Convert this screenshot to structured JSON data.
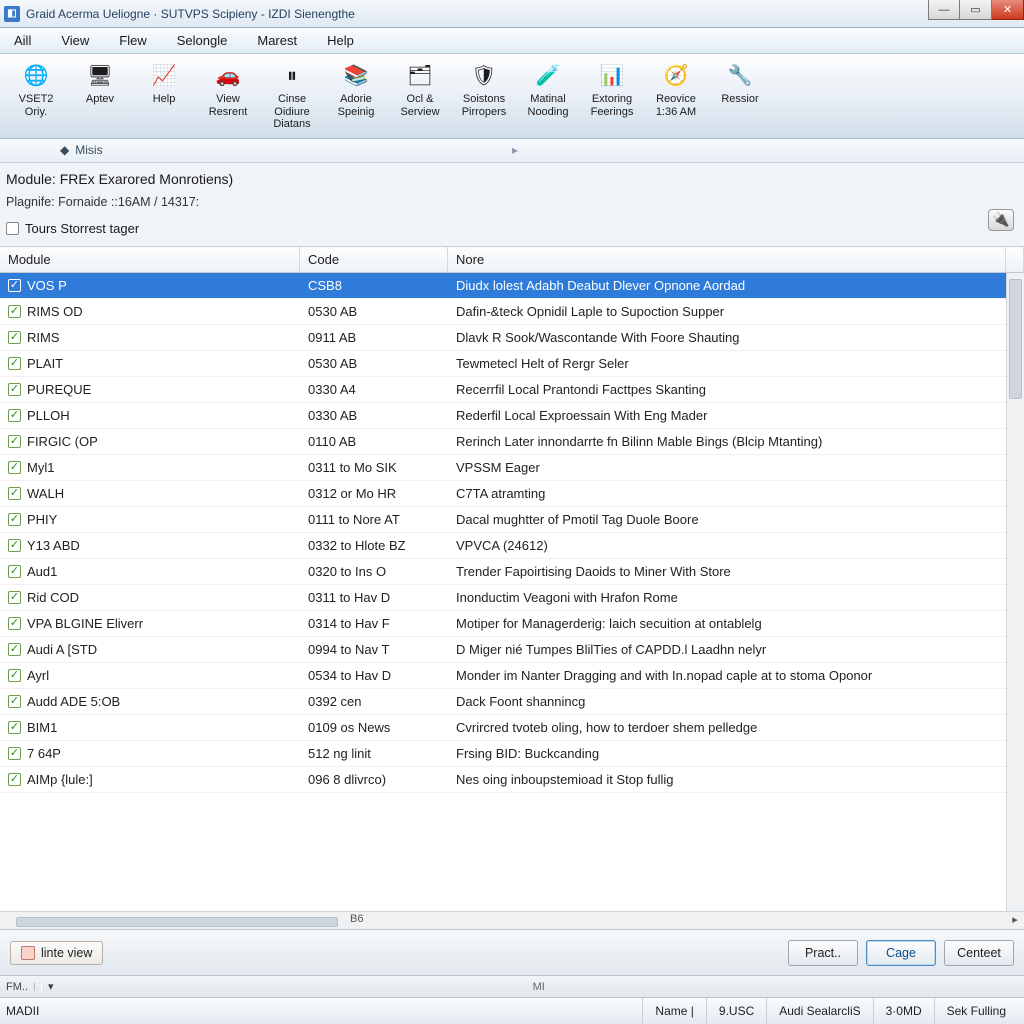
{
  "window": {
    "title": "Graid Acerma Ueliogne · SUTVPS Scipieny - IZDI Sienengthe"
  },
  "menu": {
    "items": [
      "Aill",
      "View",
      "Flew",
      "Selongle",
      "Marest",
      "Help"
    ]
  },
  "ribbon": {
    "buttons": [
      {
        "id": "vset2",
        "line1": "VSET2",
        "line2": "Oriy.",
        "icon": "🌐"
      },
      {
        "id": "aptev",
        "line1": "Aptev",
        "line2": "",
        "icon": "🖥"
      },
      {
        "id": "help",
        "line1": "Help",
        "line2": "",
        "icon": "📈"
      },
      {
        "id": "view-resent",
        "line1": "View",
        "line2": "Resrent",
        "icon": "🚗"
      },
      {
        "id": "cinse",
        "line1": "Cinse",
        "line2": "Oidiure Diatans",
        "icon": "⏸"
      },
      {
        "id": "adobe",
        "line1": "Adorie",
        "line2": "Speinig",
        "icon": "📚"
      },
      {
        "id": "ocl",
        "line1": "Ocl &",
        "line2": "Serview",
        "icon": "🗂"
      },
      {
        "id": "soistons",
        "line1": "Soistons",
        "line2": "Pirropers",
        "icon": "🛡"
      },
      {
        "id": "matinal",
        "line1": "Matinal",
        "line2": "Nooding",
        "icon": "🧪"
      },
      {
        "id": "extoring",
        "line1": "Extoring",
        "line2": "Feerings",
        "icon": "📊"
      },
      {
        "id": "reovice",
        "line1": "Reovice",
        "line2": "1:36 AM",
        "icon": "🧭"
      },
      {
        "id": "ressior",
        "line1": "Ressior",
        "line2": "",
        "icon": "🔧"
      }
    ]
  },
  "breadcrumb": {
    "label": "Misis"
  },
  "context": {
    "module_label": "Module: FREx Exarored Monrotiens)",
    "plagnife": "Plagnife: Fornaide ::16AM / 14317:",
    "toggle_label": "Tours Storrest tager"
  },
  "table": {
    "columns": {
      "module": "Module",
      "code": "Code",
      "note": "Nore"
    },
    "hscroll_label": "B6",
    "rows": [
      {
        "checked": true,
        "module": "VOS P",
        "code": "CSB8",
        "note": "Diudx lolest Adabh Deabut Dlever Opnone Aordad",
        "selected": true
      },
      {
        "checked": true,
        "module": "RIMS OD",
        "code": "0530 AB",
        "note": "Dafin-&teck Opnidil Laple to Supoction Supper"
      },
      {
        "checked": true,
        "module": "RIMS",
        "code": "0911 AB",
        "note": "Dlavk R Sook/Wascontande With Foore Shauting"
      },
      {
        "checked": true,
        "module": "PLAIT",
        "code": "0530 AB",
        "note": "Tewmetecl Helt of Rergr Seler"
      },
      {
        "checked": true,
        "module": "PUREQUE",
        "code": "0330 A4",
        "note": "Recerrfil Local Prantondi Facttpes Skanting"
      },
      {
        "checked": true,
        "module": "PLLOH",
        "code": "0330 AB",
        "note": "Rederfil Local Exproessain With Eng Mader"
      },
      {
        "checked": true,
        "module": "FIRGIC (OP",
        "code": "0110 AB",
        "note": "Rerinch Later innondarrte fn Bilinn Mable Bings (Blcip Mtanting)"
      },
      {
        "checked": true,
        "module": "Myl1",
        "code": "0311 to Mo SIK",
        "note": "VPSSM Eager"
      },
      {
        "checked": true,
        "module": "WALH",
        "code": "0312 or Mo HR",
        "note": "C7TA atramting"
      },
      {
        "checked": true,
        "module": "PHIY",
        "code": "0111 to Nore AT",
        "note": "Dacal mughtter of Pmotil Tag Duole Boore"
      },
      {
        "checked": true,
        "module": "Y13 ABD",
        "code": "0332 to Hlote BZ",
        "note": "VPVCA (24612)"
      },
      {
        "checked": true,
        "module": "Aud1",
        "code": "0320 to Ins O",
        "note": "Trender Fapoirtising Daoids to Miner With Store"
      },
      {
        "checked": true,
        "module": "Rid COD",
        "code": "0311 to Hav D",
        "note": "Inonductim Veagoni with Hrafon Rome"
      },
      {
        "checked": true,
        "module": "VPA BLGINE Eliverr",
        "code": "0314 to Hav F",
        "note": "Motiper for Managerderig: laich secuition at ontablelg"
      },
      {
        "checked": true,
        "module": "Audi A [STD",
        "code": "0994 to Nav T",
        "note": "D Miger nié Tumpes BlilTies of CAPDD.l Laadhn nelyr"
      },
      {
        "checked": true,
        "module": "Ayrl",
        "code": "0534 to Hav D",
        "note": "Monder im Nanter Dragging and with In.nopad caple at to stoma Oponor"
      },
      {
        "checked": true,
        "module": "Audd ADE 5:OB",
        "code": "0392 cen",
        "note": "Dack Foont shannincg"
      },
      {
        "checked": true,
        "module": "BIM1",
        "code": "0109 os News",
        "note": "Cvrircred tvoteb oling, how to terdoer shem pelledge"
      },
      {
        "checked": true,
        "module": "7 64P",
        "code": "512 ng linit",
        "note": "Frsing BID: Buckcanding"
      },
      {
        "checked": true,
        "module": "AIMp {lule:]",
        "code": "096 8 dlivrco)",
        "note": "Nes oing inboupstemioad it Stop fullig"
      }
    ]
  },
  "actions": {
    "linte_view": "linte view",
    "pract": "Pract..",
    "cage": "Cage",
    "centeet": "Centeet"
  },
  "slim": {
    "left": "FM..",
    "mid": "MI"
  },
  "status": {
    "left": "MADII",
    "cells": [
      "Name |",
      "9.USC",
      "Audi SealarcliS",
      "3·0MD",
      "Sek Fulling"
    ]
  }
}
